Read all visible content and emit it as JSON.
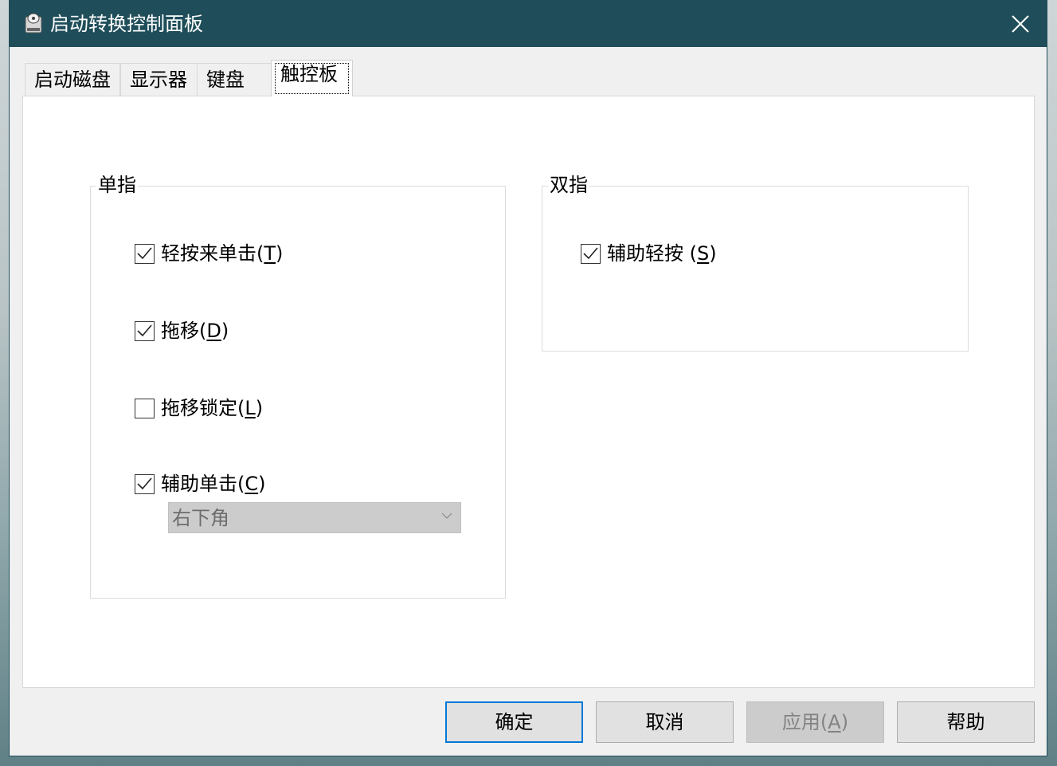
{
  "window": {
    "title": "启动转换控制面板"
  },
  "tabs": [
    {
      "label": "启动磁盘"
    },
    {
      "label": "显示器"
    },
    {
      "label": "键盘"
    },
    {
      "label": "触控板",
      "active": true
    }
  ],
  "single_finger": {
    "title": "单指",
    "options": [
      {
        "label_pre": "轻按来单击(",
        "mnemonic": "T",
        "label_post": ")",
        "checked": true
      },
      {
        "label_pre": "拖移(",
        "mnemonic": "D",
        "label_post": ")",
        "checked": true
      },
      {
        "label_pre": "拖移锁定(",
        "mnemonic": "L",
        "label_post": ")",
        "checked": false
      },
      {
        "label_pre": "辅助单击(",
        "mnemonic": "C",
        "label_post": ")",
        "checked": true
      }
    ],
    "secondary_click_corner": {
      "selected": "右下角",
      "disabled": true
    }
  },
  "two_finger": {
    "title": "双指",
    "options": [
      {
        "label_pre": "辅助轻按 (",
        "mnemonic": "S",
        "label_post": ")",
        "checked": true
      }
    ]
  },
  "buttons": {
    "ok": "确定",
    "cancel": "取消",
    "apply_pre": "应用(",
    "apply_mnemonic": "A",
    "apply_post": ")",
    "help": "帮助"
  },
  "colors": {
    "titlebar": "#1f4e5a",
    "window_bg": "#f0f0f0",
    "panel_bg": "#ffffff",
    "focus_border": "#0078d7"
  },
  "icons": {
    "app": "bootcamp-disk-icon",
    "close": "close-icon",
    "check": "checkmark-icon",
    "dropdown": "chevron-down-icon"
  }
}
